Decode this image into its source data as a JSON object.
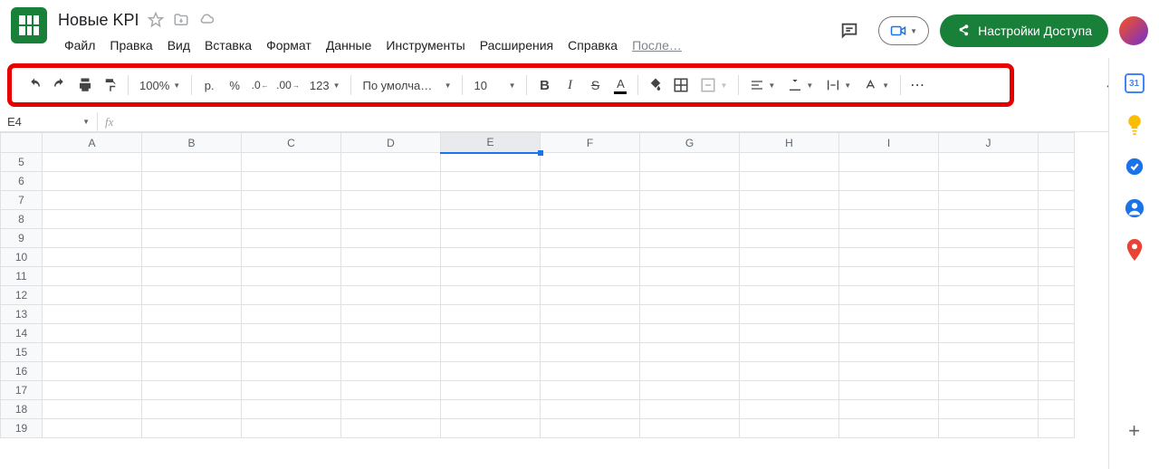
{
  "doc": {
    "title": "Новые KPI"
  },
  "menu": {
    "items": [
      "Файл",
      "Правка",
      "Вид",
      "Вставка",
      "Формат",
      "Данные",
      "Инструменты",
      "Расширения",
      "Справка"
    ],
    "last_edit": "После…"
  },
  "share": {
    "label": "Настройки Доступа"
  },
  "toolbar": {
    "zoom": "100%",
    "currency_symbol": "р.",
    "percent_symbol": "%",
    "dec_decrease": ".0",
    "dec_increase": ".00",
    "format_label": "123",
    "font": "По умолча…",
    "font_size": "10",
    "bold": "B",
    "italic": "I",
    "strike": "S",
    "text_color": "A",
    "more": "⋯"
  },
  "namebox": {
    "value": "E4"
  },
  "formula_bar": {
    "fx": "fx"
  },
  "grid": {
    "columns": [
      "A",
      "B",
      "C",
      "D",
      "E",
      "F",
      "G",
      "H",
      "I",
      "J"
    ],
    "rows": [
      5,
      6,
      7,
      8,
      9,
      10,
      11,
      12,
      13,
      14,
      15,
      16,
      17,
      18,
      19
    ],
    "selected_col_index": 4
  },
  "side_panel": {
    "calendar_day": "31"
  }
}
